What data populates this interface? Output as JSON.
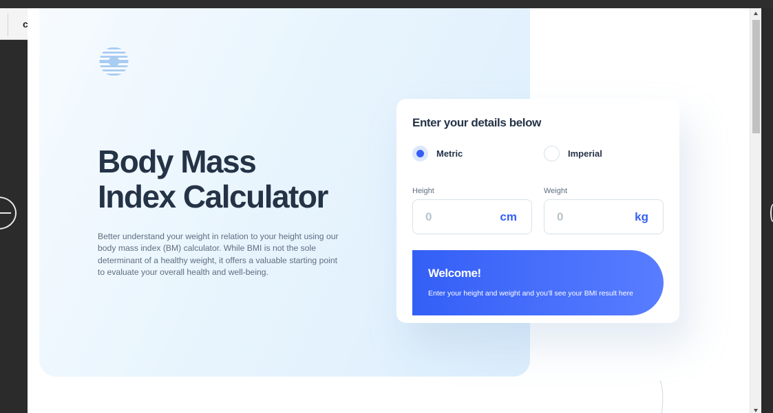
{
  "background_app": {
    "tab_char": "c"
  },
  "hero": {
    "logo": "striped-globe-logo",
    "title_line1": "Body Mass",
    "title_line2": "Index Calculator",
    "description": "Better understand your weight in relation to your height using our body mass index (BM) calculator. While BMI is not the sole determinant of a healthy weight, it offers a valuable starting point to evaluate your overall health and well-being."
  },
  "form": {
    "heading": "Enter your details below",
    "unit_options": [
      {
        "label": "Metric",
        "checked": true
      },
      {
        "label": "Imperial",
        "checked": false
      }
    ],
    "height": {
      "label": "Height",
      "placeholder": "0",
      "unit": "cm"
    },
    "weight": {
      "label": "Weight",
      "placeholder": "0",
      "unit": "kg"
    }
  },
  "result": {
    "title": "Welcome!",
    "body": "Enter your height and weight and you'll see your BMI result here"
  },
  "colors": {
    "accent": "#345ff6",
    "heading": "#253347",
    "body_text": "#5e6e80",
    "border": "#d8e2e7"
  }
}
